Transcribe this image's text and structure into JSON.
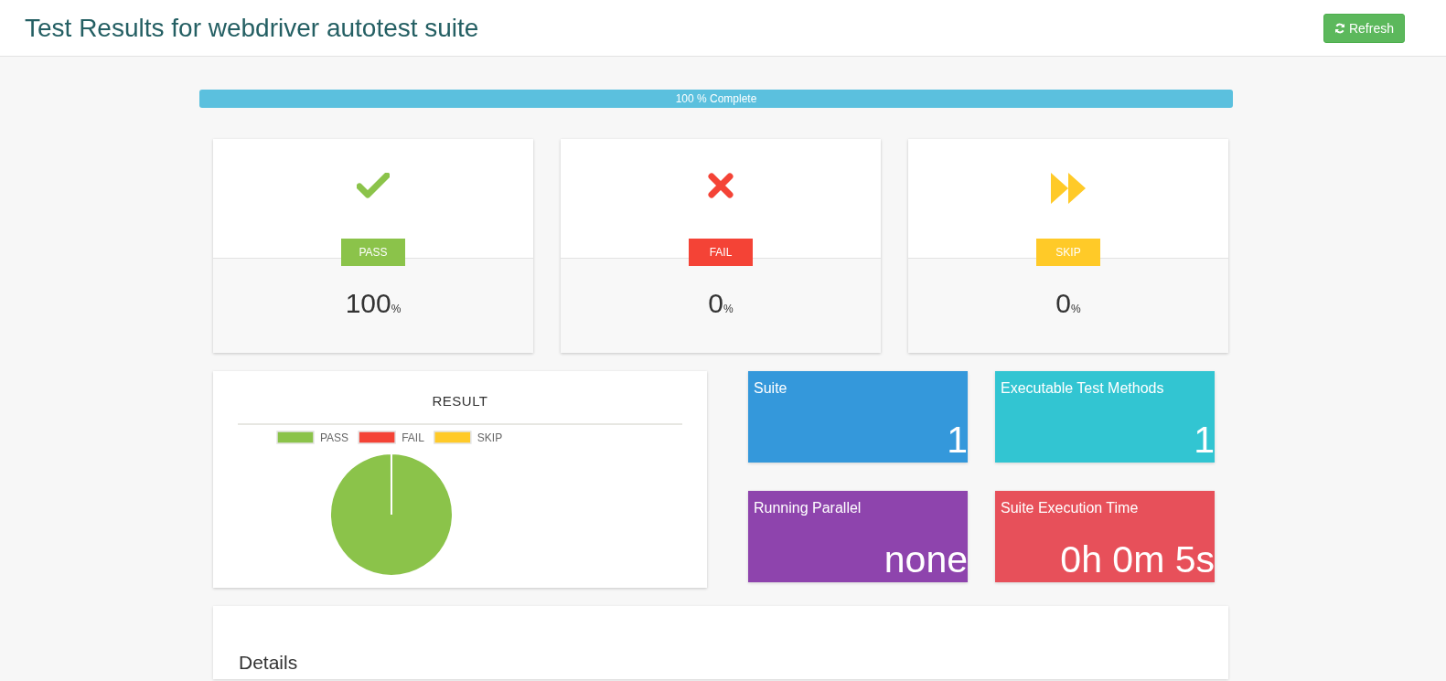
{
  "header": {
    "title": "Test Results for webdriver autotest suite",
    "refresh_button": "Refresh"
  },
  "progress": {
    "level": 1,
    "label": "100 % Complete"
  },
  "stat_cards": [
    {
      "kind": "pass",
      "badge": "PASS",
      "value": "100",
      "unit": "%"
    },
    {
      "kind": "fail",
      "badge": "FAIL",
      "value": "0",
      "unit": "%"
    },
    {
      "kind": "skip",
      "badge": "SKIP",
      "value": "0",
      "unit": "%"
    }
  ],
  "result_chart": {
    "chart_data": {
      "type": "pie",
      "title": "RESULT",
      "categories": [
        "PASS",
        "FAIL",
        "SKIP"
      ],
      "colors": [
        "#8bc34a",
        "#f44336",
        "#ffca28"
      ],
      "series": [
        {
          "values": [
            100,
            0,
            0
          ]
        }
      ]
    }
  },
  "tiles": [
    {
      "title": "Suite",
      "value": "1",
      "color": "#3498db"
    },
    {
      "title": "Executable Test Methods",
      "value": "1",
      "color": "#32c5d2"
    },
    {
      "title": "Running Parallel",
      "value": "none",
      "color": "#8e44ad"
    },
    {
      "title": "Suite Execution Time",
      "value": "0h 0m 5s",
      "color": "#e7505a"
    }
  ],
  "details": {
    "title": "Details"
  }
}
